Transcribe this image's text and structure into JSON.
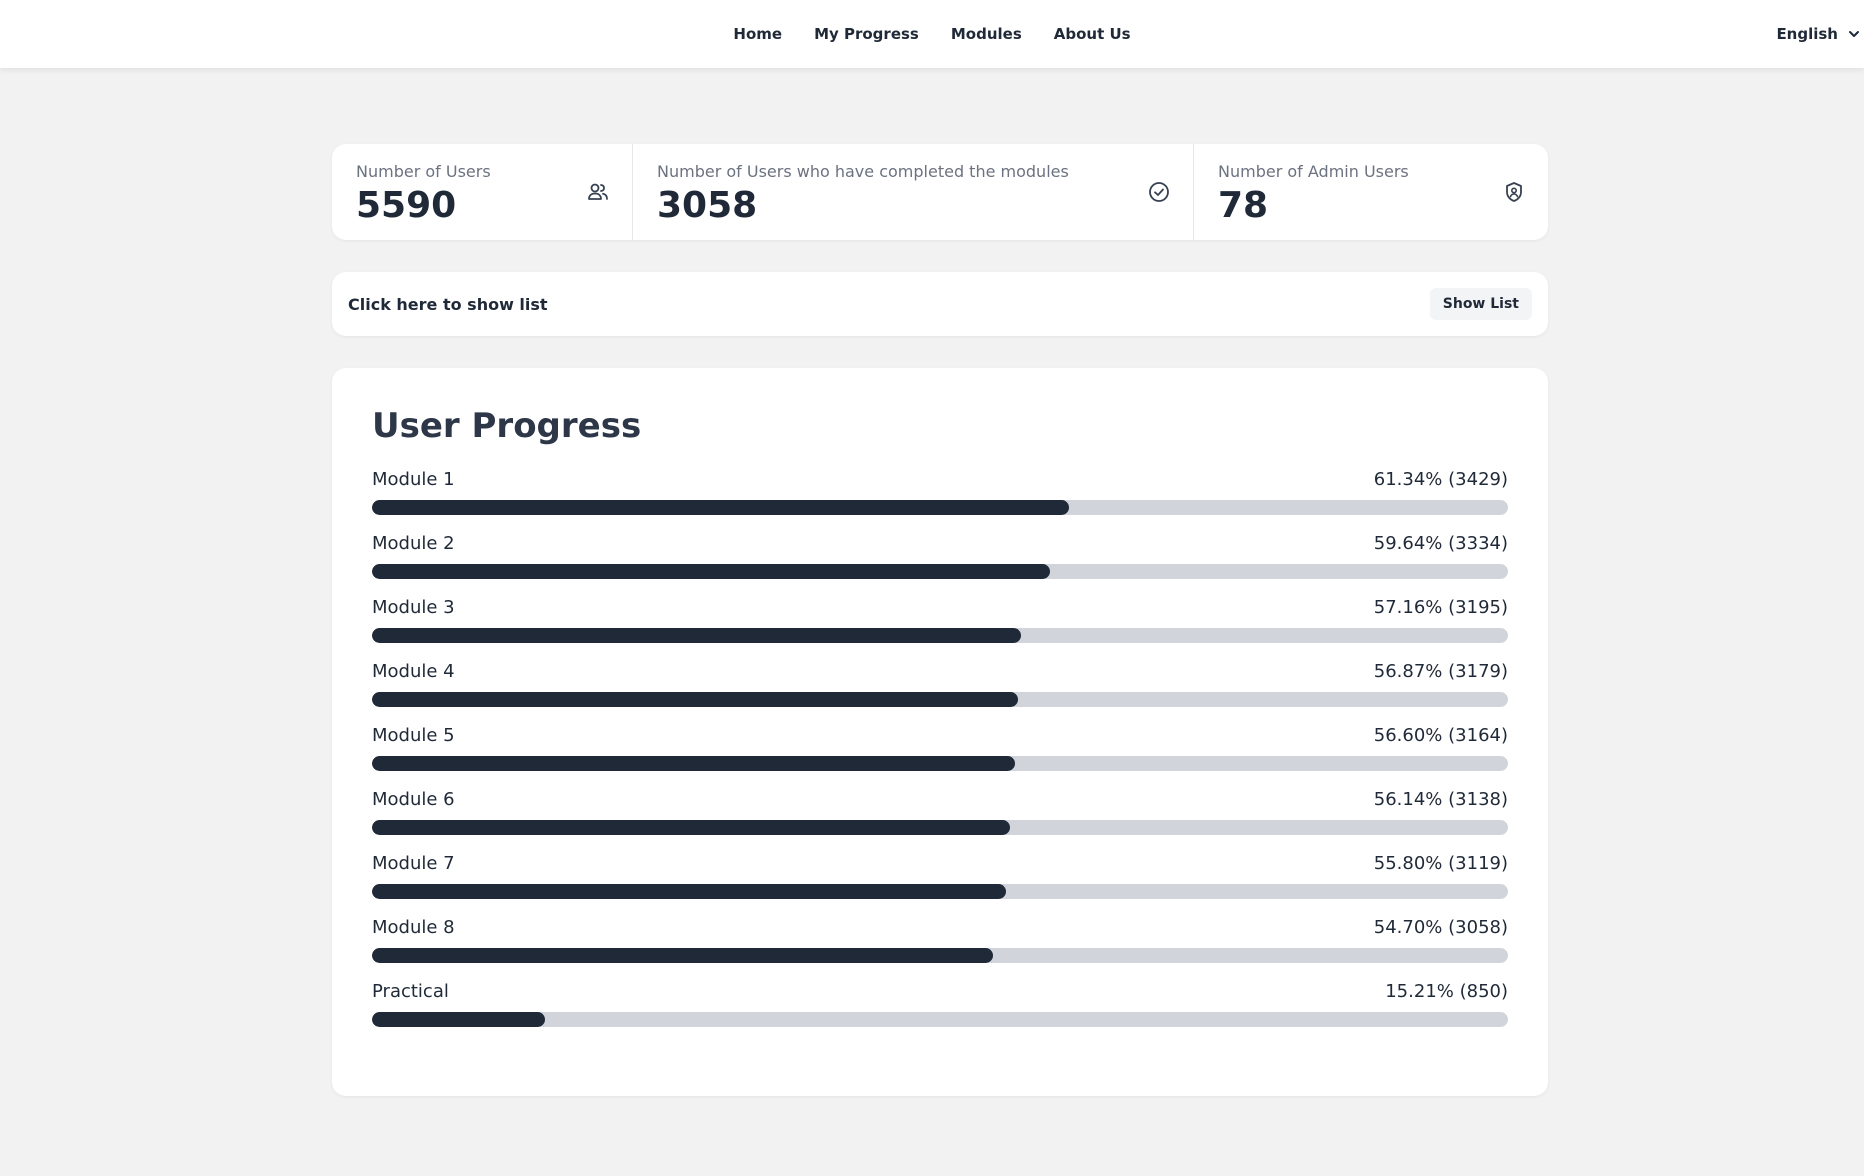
{
  "nav": {
    "links": [
      "Home",
      "My Progress",
      "Modules",
      "About Us"
    ],
    "language": "English"
  },
  "stats": [
    {
      "label": "Number of Users",
      "value": "5590",
      "icon": "users-icon"
    },
    {
      "label": "Number of Users who have completed the modules",
      "value": "3058",
      "icon": "check-circle-icon"
    },
    {
      "label": "Number of Admin Users",
      "value": "78",
      "icon": "shield-user-icon"
    }
  ],
  "list_bar": {
    "text": "Click here to show list",
    "button_label": "Show List"
  },
  "progress": {
    "title": "User Progress",
    "items": [
      {
        "label": "Module 1",
        "value_text": "61.34% (3429)",
        "percent": 61.34
      },
      {
        "label": "Module 2",
        "value_text": "59.64% (3334)",
        "percent": 59.64
      },
      {
        "label": "Module 3",
        "value_text": "57.16% (3195)",
        "percent": 57.16
      },
      {
        "label": "Module 4",
        "value_text": "56.87% (3179)",
        "percent": 56.87
      },
      {
        "label": "Module 5",
        "value_text": "56.60% (3164)",
        "percent": 56.6
      },
      {
        "label": "Module 6",
        "value_text": "56.14% (3138)",
        "percent": 56.14
      },
      {
        "label": "Module 7",
        "value_text": "55.80% (3119)",
        "percent": 55.8
      },
      {
        "label": "Module 8",
        "value_text": "54.70% (3058)",
        "percent": 54.7
      },
      {
        "label": "Practical",
        "value_text": "15.21% (850)",
        "percent": 15.21
      }
    ]
  },
  "colors": {
    "page_bg": "#f2f2f2",
    "bar_fill": "#1f2937",
    "bar_track": "#d1d5db",
    "text": "#1f2937"
  }
}
